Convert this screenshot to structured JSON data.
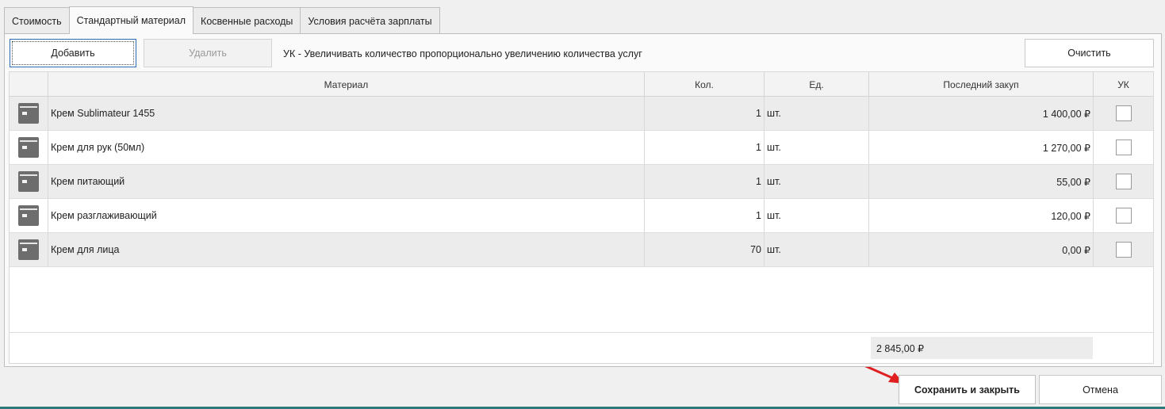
{
  "tabs": [
    {
      "label": "Стоимость"
    },
    {
      "label": "Стандартный материал"
    },
    {
      "label": "Косвенные расходы"
    },
    {
      "label": "Условия расчёта зарплаты"
    }
  ],
  "toolbar": {
    "add_label": "Добавить",
    "delete_label": "Удалить",
    "hint": "УК - Увеличивать количество пропорционально увеличению количества услуг",
    "clear_label": "Очистить"
  },
  "table": {
    "columns": [
      "",
      "Материал",
      "Кол.",
      "Ед.",
      "Последний закуп",
      "УК"
    ],
    "rows": [
      {
        "material": "Крем Sublimateur 1455",
        "qty": "1",
        "unit": "шт.",
        "last_purchase": "1 400,00 ₽",
        "uk": false
      },
      {
        "material": "Крем для рук (50мл)",
        "qty": "1",
        "unit": "шт.",
        "last_purchase": "1 270,00 ₽",
        "uk": false
      },
      {
        "material": "Крем питающий",
        "qty": "1",
        "unit": "шт.",
        "last_purchase": "55,00 ₽",
        "uk": false
      },
      {
        "material": "Крем разглаживающий",
        "qty": "1",
        "unit": "шт.",
        "last_purchase": "120,00 ₽",
        "uk": false
      },
      {
        "material": "Крем для лица",
        "qty": "70",
        "unit": "шт.",
        "last_purchase": "0,00 ₽",
        "uk": false
      }
    ],
    "total": "2 845,00 ₽"
  },
  "footer": {
    "save_label": "Сохранить и закрыть",
    "cancel_label": "Отмена"
  },
  "colors": {
    "accent_border": "#2d6db5",
    "arrow": "#e02020",
    "bottom_line": "#2c7a7a"
  },
  "icons": {
    "row_icon": "material-box-icon"
  }
}
